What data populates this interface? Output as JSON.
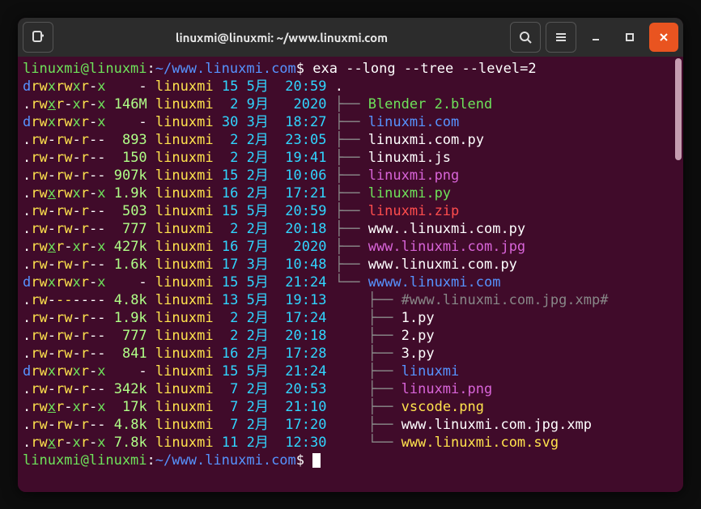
{
  "title": "linuxmi@linuxmi: ~/www.linuxmi.com",
  "prompt": {
    "user": "linuxmi",
    "host": "linuxmi",
    "sep": "@",
    "colon": ":",
    "path": "~/www.linuxmi.com",
    "dollar": "$"
  },
  "command": "exa --long --tree --level=2",
  "tree": {
    "rootDot": ".",
    "tee": "├── ",
    "corner": "└── ",
    "pipe": "│   ",
    "space": "    "
  },
  "lines": [
    {
      "perm": [
        "d",
        "rw",
        "x",
        "rw",
        "x",
        "r-x"
      ],
      "size": "   -",
      "sizeClass": "w",
      "user": "linuxmi",
      "d1": "15",
      "d2": "5月",
      "time": "20:59",
      "depth": 0,
      "kind": "dot",
      "name": "",
      "nameClass": "w"
    },
    {
      "perm": [
        ".",
        "rw",
        "x",
        "r-x",
        "r-x"
      ],
      "underlineX": true,
      "size": "146M",
      "sizeClass": "lg",
      "user": "linuxmi",
      "d1": " 2",
      "d2": "9月",
      "time": " 2020",
      "depth": 1,
      "last": false,
      "name": "Blender 2.blend",
      "nameClass": "g"
    },
    {
      "perm": [
        "d",
        "rw",
        "x",
        "rw",
        "x",
        "r-x"
      ],
      "size": "   -",
      "sizeClass": "w",
      "user": "linuxmi",
      "d1": "30",
      "d2": "3月",
      "time": "18:27",
      "depth": 1,
      "last": false,
      "name": "linuxmi.com",
      "nameClass": "b"
    },
    {
      "perm": [
        ".",
        "rw",
        "-",
        "rw",
        "-",
        "r--"
      ],
      "size": " 893",
      "sizeClass": "lg",
      "user": "linuxmi",
      "d1": " 2",
      "d2": "2月",
      "time": "23:05",
      "depth": 1,
      "last": false,
      "name": "linuxmi.com.py",
      "nameClass": "w"
    },
    {
      "perm": [
        ".",
        "rw",
        "-",
        "rw",
        "-",
        "r--"
      ],
      "size": " 150",
      "sizeClass": "lg",
      "user": "linuxmi",
      "d1": " 2",
      "d2": "2月",
      "time": "19:41",
      "depth": 1,
      "last": false,
      "name": "linuxmi.js",
      "nameClass": "w"
    },
    {
      "perm": [
        ".",
        "rw",
        "-",
        "rw",
        "-",
        "r--"
      ],
      "size": "907k",
      "sizeClass": "lg",
      "user": "linuxmi",
      "d1": "15",
      "d2": "2月",
      "time": "10:06",
      "depth": 1,
      "last": false,
      "name": "linuxmi.png",
      "nameClass": "m"
    },
    {
      "perm": [
        ".",
        "rw",
        "x",
        "rw",
        "x",
        "r-x"
      ],
      "underlineX": true,
      "size": "1.9k",
      "sizeClass": "lg",
      "user": "linuxmi",
      "d1": "16",
      "d2": "2月",
      "time": "17:21",
      "depth": 1,
      "last": false,
      "name": "linuxmi.py",
      "nameClass": "g"
    },
    {
      "perm": [
        ".",
        "rw",
        "-",
        "rw",
        "-",
        "r--"
      ],
      "size": " 503",
      "sizeClass": "lg",
      "user": "linuxmi",
      "d1": "15",
      "d2": "5月",
      "time": "20:59",
      "depth": 1,
      "last": false,
      "name": "linuxmi.zip",
      "nameClass": "r"
    },
    {
      "perm": [
        ".",
        "rw",
        "-",
        "rw",
        "-",
        "r--"
      ],
      "size": " 777",
      "sizeClass": "lg",
      "user": "linuxmi",
      "d1": " 2",
      "d2": "2月",
      "time": "20:18",
      "depth": 1,
      "last": false,
      "name": "www..linuxmi.com.py",
      "nameClass": "w"
    },
    {
      "perm": [
        ".",
        "rw",
        "x",
        "r-x",
        "r-x"
      ],
      "underlineX": true,
      "size": "427k",
      "sizeClass": "lg",
      "user": "linuxmi",
      "d1": "16",
      "d2": "7月",
      "time": " 2020",
      "depth": 1,
      "last": false,
      "name": "www.linuxmi.com.jpg",
      "nameClass": "m"
    },
    {
      "perm": [
        ".",
        "rw",
        "-",
        "rw",
        "-",
        "r--"
      ],
      "size": "1.6k",
      "sizeClass": "lg",
      "user": "linuxmi",
      "d1": "17",
      "d2": "3月",
      "time": "10:48",
      "depth": 1,
      "last": false,
      "name": "www.linuxmi.com.py",
      "nameClass": "w"
    },
    {
      "perm": [
        "d",
        "rw",
        "x",
        "rw",
        "x",
        "r-x"
      ],
      "size": "   -",
      "sizeClass": "w",
      "user": "linuxmi",
      "d1": "15",
      "d2": "5月",
      "time": "21:24",
      "depth": 1,
      "last": true,
      "name": "wwww.linuxmi.com",
      "nameClass": "b"
    },
    {
      "perm": [
        ".",
        "rw",
        "-",
        "--",
        "-",
        "---"
      ],
      "size": "4.8k",
      "sizeClass": "lg",
      "user": "linuxmi",
      "d1": "13",
      "d2": "5月",
      "time": "19:13",
      "depth": 2,
      "last": false,
      "name": "#www.linuxmi.com.jpg.xmp#",
      "nameClass": "gr"
    },
    {
      "perm": [
        ".",
        "rw",
        "-",
        "rw",
        "-",
        "r--"
      ],
      "size": "1.9k",
      "sizeClass": "lg",
      "user": "linuxmi",
      "d1": " 2",
      "d2": "2月",
      "time": "17:24",
      "depth": 2,
      "last": false,
      "name": "1.py",
      "nameClass": "w"
    },
    {
      "perm": [
        ".",
        "rw",
        "-",
        "rw",
        "-",
        "r--"
      ],
      "size": " 777",
      "sizeClass": "lg",
      "user": "linuxmi",
      "d1": " 2",
      "d2": "2月",
      "time": "20:18",
      "depth": 2,
      "last": false,
      "name": "2.py",
      "nameClass": "w"
    },
    {
      "perm": [
        ".",
        "rw",
        "-",
        "rw",
        "-",
        "r--"
      ],
      "size": " 841",
      "sizeClass": "lg",
      "user": "linuxmi",
      "d1": "16",
      "d2": "2月",
      "time": "17:28",
      "depth": 2,
      "last": false,
      "name": "3.py",
      "nameClass": "w"
    },
    {
      "perm": [
        "d",
        "rw",
        "x",
        "rw",
        "x",
        "r-x"
      ],
      "size": "   -",
      "sizeClass": "w",
      "user": "linuxmi",
      "d1": "15",
      "d2": "5月",
      "time": "21:24",
      "depth": 2,
      "last": false,
      "name": "linuxmi",
      "nameClass": "b"
    },
    {
      "perm": [
        ".",
        "rw",
        "-",
        "rw",
        "-",
        "r--"
      ],
      "size": "342k",
      "sizeClass": "lg",
      "user": "linuxmi",
      "d1": " 7",
      "d2": "2月",
      "time": "20:53",
      "depth": 2,
      "last": false,
      "name": "linuxmi.png",
      "nameClass": "m"
    },
    {
      "perm": [
        ".",
        "rw",
        "x",
        "r-x",
        "r-x"
      ],
      "underlineX": true,
      "size": " 17k",
      "sizeClass": "lg",
      "user": "linuxmi",
      "d1": " 7",
      "d2": "2月",
      "time": "21:10",
      "depth": 2,
      "last": false,
      "name": "vscode.png",
      "nameClass": "y"
    },
    {
      "perm": [
        ".",
        "rw",
        "-",
        "rw",
        "-",
        "r--"
      ],
      "size": "4.8k",
      "sizeClass": "lg",
      "user": "linuxmi",
      "d1": " 7",
      "d2": "2月",
      "time": "17:20",
      "depth": 2,
      "last": false,
      "name": "www.linuxmi.com.jpg.xmp",
      "nameClass": "w"
    },
    {
      "perm": [
        ".",
        "rw",
        "x",
        "r-x",
        "r-x"
      ],
      "underlineX": true,
      "size": "7.8k",
      "sizeClass": "lg",
      "user": "linuxmi",
      "d1": "11",
      "d2": "2月",
      "time": "12:30",
      "depth": 2,
      "last": true,
      "name": "www.linuxmi.com.svg",
      "nameClass": "y"
    }
  ]
}
